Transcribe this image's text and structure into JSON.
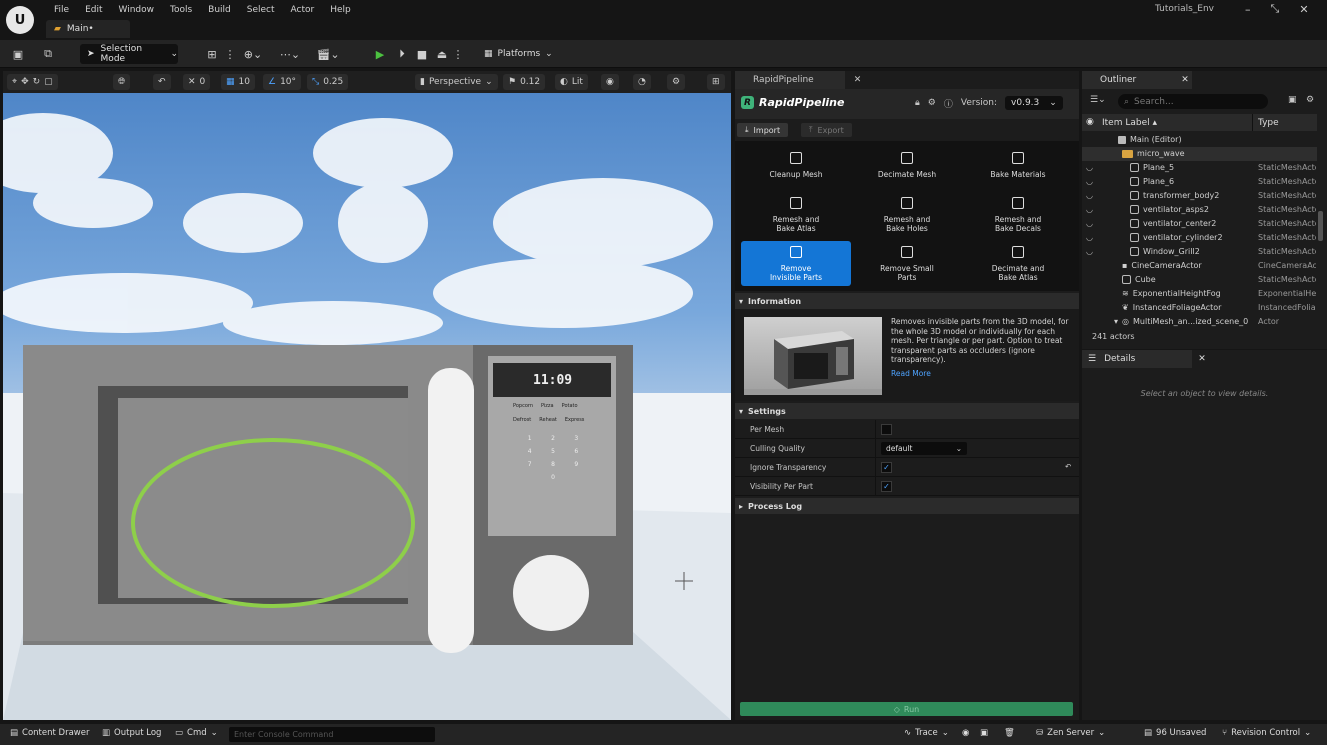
{
  "menubar": {
    "items": [
      "File",
      "Edit",
      "Window",
      "Tools",
      "Build",
      "Select",
      "Actor",
      "Help"
    ],
    "tab": "Main•",
    "project": "Tutorials_Env",
    "win_controls": [
      "–",
      "⤡",
      "✕"
    ]
  },
  "toolbar": {
    "selection_mode": "Selection Mode",
    "platforms": "Platforms"
  },
  "viewport_bar": {
    "rotate_snap": "0",
    "grid_snap": "10",
    "angle_snap": "10°",
    "scale_snap": "0.25",
    "perspective": "Perspective",
    "speed": "0.12",
    "lit": "Lit"
  },
  "scene": {
    "clock": "11:09",
    "keypad_top": [
      "Popcorn",
      "Pizza",
      "Potato"
    ],
    "keypad_mid": [
      "Defrost",
      "Reheat",
      "Express"
    ],
    "keypad_digits": [
      "1",
      "2",
      "3",
      "4",
      "5",
      "6",
      "7",
      "8",
      "9",
      "0"
    ]
  },
  "rapidpipeline": {
    "tab": "RapidPipeline",
    "title": "RapidPipeline",
    "version_label": "Version:",
    "version": "v0.9.3",
    "import": "Import",
    "export": "Export",
    "tiles": [
      {
        "label": "Cleanup Mesh"
      },
      {
        "label": "Decimate Mesh"
      },
      {
        "label": "Bake Materials"
      },
      {
        "label": "Remesh and Bake Atlas"
      },
      {
        "label": "Remesh and Bake Holes"
      },
      {
        "label": "Remesh and Bake Decals"
      },
      {
        "label": "Remove Invisible Parts"
      },
      {
        "label": "Remove Small Parts"
      },
      {
        "label": "Decimate and Bake Atlas"
      }
    ],
    "information_header": "Information",
    "info_text": "Removes invisible parts from the 3D model, for the whole 3D model or individually for each mesh. Per triangle or per part. Option to treat transparent parts as occluders (ignore transparency).",
    "read_more": "Read More",
    "settings_header": "Settings",
    "settings": {
      "per_mesh": "Per Mesh",
      "culling_quality": "Culling Quality",
      "culling_value": "default",
      "ignore_transparency": "Ignore Transparency",
      "visibility_per_part": "Visibility Per Part"
    },
    "process_log": "Process Log",
    "run": "Run"
  },
  "outliner": {
    "tab": "Outliner",
    "search_placeholder": "Search...",
    "col_label": "Item Label ▴",
    "col_type": "Type",
    "rows": [
      {
        "name": "Main (Editor)",
        "type": ""
      },
      {
        "name": "micro_wave",
        "type": ""
      },
      {
        "name": "Plane_5",
        "type": "StaticMeshActor"
      },
      {
        "name": "Plane_6",
        "type": "StaticMeshActor"
      },
      {
        "name": "transformer_body2",
        "type": "StaticMeshActor"
      },
      {
        "name": "ventilator_asps2",
        "type": "StaticMeshActor"
      },
      {
        "name": "ventilator_center2",
        "type": "StaticMeshActor"
      },
      {
        "name": "ventilator_cylinder2",
        "type": "StaticMeshActor"
      },
      {
        "name": "Window_Grill2",
        "type": "StaticMeshActor"
      },
      {
        "name": "CineCameraActor",
        "type": "CineCameraActor"
      },
      {
        "name": "Cube",
        "type": "StaticMeshActor"
      },
      {
        "name": "ExponentialHeightFog",
        "type": "ExponentialHeightFog"
      },
      {
        "name": "InstancedFoliageActor",
        "type": "InstancedFoliageActor"
      },
      {
        "name": "MultiMesh_an...ized_scene_0",
        "type": "Actor"
      }
    ],
    "count": "241 actors"
  },
  "details": {
    "tab": "Details",
    "empty": "Select an object to view details."
  },
  "statusbar": {
    "content_drawer": "Content Drawer",
    "output_log": "Output Log",
    "cmd": "Cmd",
    "console_placeholder": "Enter Console Command",
    "trace": "Trace",
    "zen": "Zen Server",
    "unsaved": "96 Unsaved",
    "revision": "Revision Control"
  }
}
